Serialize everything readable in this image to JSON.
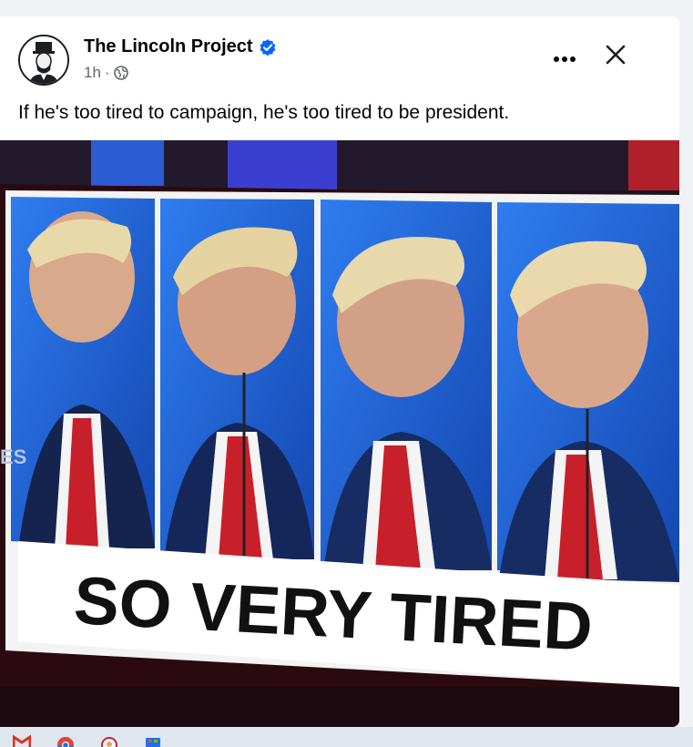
{
  "post": {
    "author": "The Lincoln Project",
    "time": "1h",
    "time_separator": "·",
    "caption": "If he's too tired to campaign, he's too tired to be president.",
    "icons": {
      "avatar": "lincoln-portrait-avatar",
      "verified": "verified-badge-icon",
      "audience": "globe-icon",
      "more": "more-options-icon",
      "close": "close-icon"
    }
  },
  "image": {
    "banner_text": "SO VERY TIRED",
    "edge_text": "ES"
  },
  "taskbar": {
    "icons": [
      "gmail-icon",
      "chrome-icon",
      "app-icon",
      "store-icon"
    ]
  },
  "colors": {
    "verified_blue": "#0866ff",
    "text_primary": "#050505",
    "text_secondary": "#65676b",
    "tv_blue": "#1b5fd6",
    "tie_red": "#c8202a"
  }
}
